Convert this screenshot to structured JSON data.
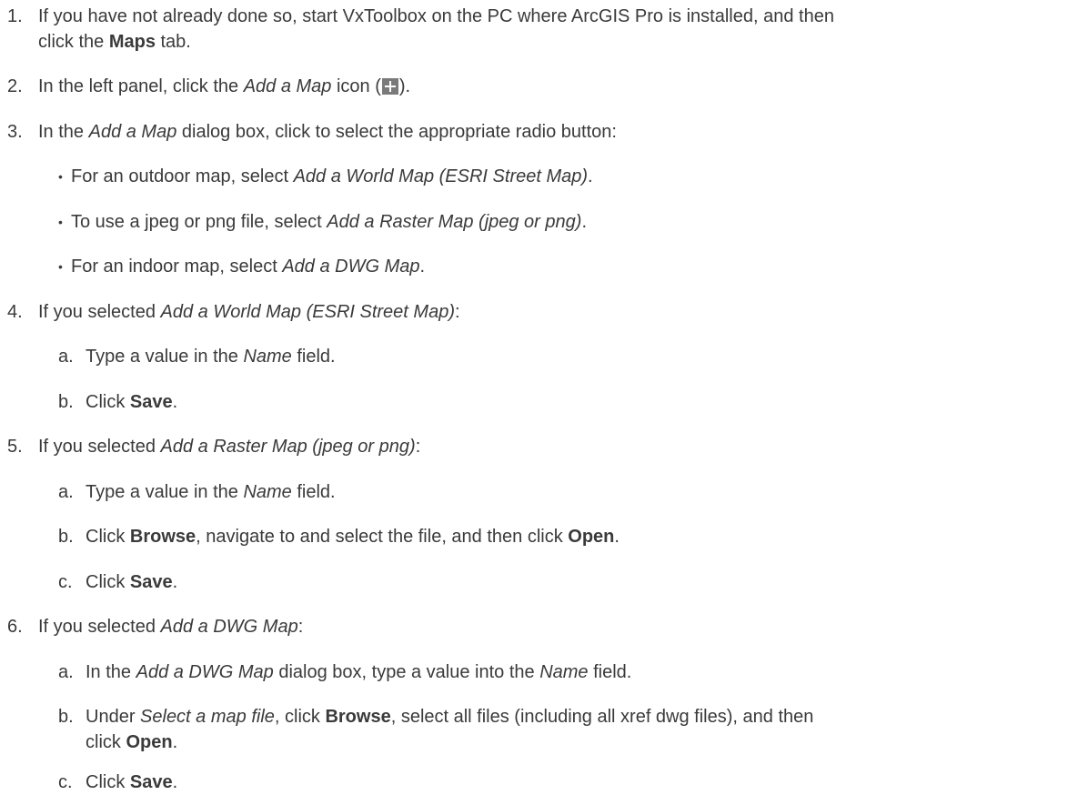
{
  "steps": [
    {
      "number": "1.",
      "line1": [
        "If you have not already done so, start VxToolbox on the PC where ArcGIS Pro is installed, and then"
      ],
      "line2": [
        "click the ",
        "Maps",
        " tab."
      ]
    },
    {
      "number": "2.",
      "parts": [
        "In the left panel, click the ",
        "Add a Map",
        " icon (",
        ")."
      ],
      "icon": "plus-icon"
    },
    {
      "number": "3.",
      "parts": [
        "In the ",
        "Add a Map",
        " dialog box, click to select the appropriate radio button:"
      ],
      "bullets": [
        [
          "For an outdoor map, select ",
          "Add a World Map (ESRI Street Map)",
          "."
        ],
        [
          "To use a jpeg or png file, select ",
          "Add a Raster Map (jpeg or png)",
          "."
        ],
        [
          "For an indoor map, select ",
          "Add a DWG Map",
          "."
        ]
      ],
      "bullet_char": "•"
    },
    {
      "number": "4.",
      "parts": [
        "If you selected ",
        "Add a World Map (ESRI Street Map)",
        ":"
      ],
      "substeps": [
        {
          "letter": "a.",
          "parts": [
            "Type a value in the ",
            "Name",
            " field."
          ]
        },
        {
          "letter": "b.",
          "parts": [
            "Click ",
            "Save",
            "."
          ]
        }
      ]
    },
    {
      "number": "5.",
      "parts": [
        "If you selected ",
        "Add a Raster Map (jpeg or png)",
        ":"
      ],
      "substeps": [
        {
          "letter": "a.",
          "parts": [
            "Type a value in the ",
            "Name",
            " field."
          ]
        },
        {
          "letter": "b.",
          "parts": [
            "Click ",
            "Browse",
            ", navigate to and select the file, and then click ",
            "Open",
            "."
          ]
        },
        {
          "letter": "c.",
          "parts": [
            "Click ",
            "Save",
            "."
          ]
        }
      ]
    },
    {
      "number": "6.",
      "parts": [
        "If you selected ",
        "Add a DWG Map",
        ":"
      ],
      "substeps": [
        {
          "letter": "a.",
          "parts": [
            "In the ",
            "Add a DWG Map",
            " dialog box, type a value into the ",
            "Name",
            " field."
          ]
        },
        {
          "letter": "b.",
          "parts": [
            "Under ",
            "Select a map file",
            ", click ",
            "Browse",
            ", select all files (including all xref dwg files), and then"
          ],
          "cont": [
            "click ",
            "Open",
            "."
          ]
        },
        {
          "letter": "c.",
          "parts": [
            "Click ",
            "Save",
            "."
          ]
        }
      ]
    }
  ]
}
